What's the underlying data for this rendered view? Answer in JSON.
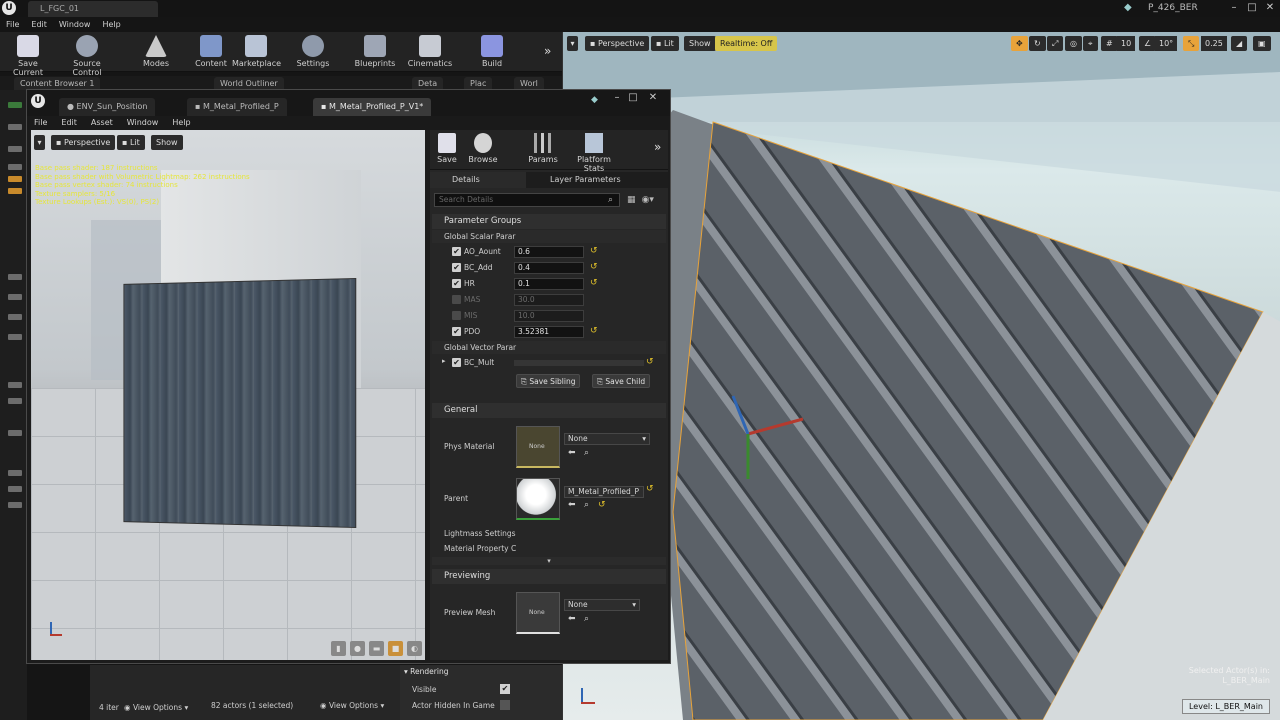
{
  "main_window": {
    "level_tab": "L_FGC_01",
    "project_name": "P_426_BER",
    "menu": [
      "File",
      "Edit",
      "Window",
      "Help"
    ]
  },
  "main_toolbar": {
    "items": [
      {
        "label": "Save Current",
        "icon": "save-icon"
      },
      {
        "label": "Source Control",
        "icon": "source-control-icon"
      },
      {
        "label": "Modes",
        "icon": "modes-icon"
      },
      {
        "label": "Content",
        "icon": "content-icon"
      },
      {
        "label": "Marketplace",
        "icon": "marketplace-icon"
      },
      {
        "label": "Settings",
        "icon": "settings-icon"
      },
      {
        "label": "Blueprints",
        "icon": "blueprints-icon"
      },
      {
        "label": "Cinematics",
        "icon": "cinematics-icon"
      },
      {
        "label": "Build",
        "icon": "build-icon"
      }
    ]
  },
  "underlay": {
    "tabs": [
      "Content Browser 1",
      "World Outliner",
      "Deta",
      "Plac",
      "Worl"
    ],
    "items_count": "4 iter",
    "view_options_1": "View Options",
    "actors_status": "82 actors (1 selected)",
    "view_options_2": "View Options",
    "rendering": {
      "title": "Rendering",
      "visible_label": "Visible",
      "actor_hidden_label": "Actor Hidden In Game"
    }
  },
  "viewport": {
    "perspective": "Perspective",
    "lit": "Lit",
    "show": "Show",
    "realtime": "Realtime: Off",
    "grid_snap": "10",
    "rot_snap": "10°",
    "scale_snap": "0.25",
    "selected_label": "Selected Actor(s) in:",
    "selected_level": "L_BER_Main",
    "level_badge": "Level:  L_BER_Main"
  },
  "material_editor": {
    "tabs": [
      "ENV_Sun_Position",
      "M_Metal_Profiled_P",
      "M_Metal_Profiled_P_V1*"
    ],
    "menu": [
      "File",
      "Edit",
      "Asset",
      "Window",
      "Help"
    ],
    "preview": {
      "perspective": "Perspective",
      "lit": "Lit",
      "show": "Show",
      "stats": [
        "Base pass shader: 187 instructions",
        "Base pass shader with Volumetric Lightmap: 262 instructions",
        "Base pass vertex shader: 74 instructions",
        "Texture samplers: 5/16",
        "Texture Lookups (Est.): VS(0), PS(2)"
      ]
    },
    "toolbar": [
      {
        "label": "Save",
        "icon": "save-icon"
      },
      {
        "label": "Browse",
        "icon": "browse-icon"
      },
      {
        "label": "Params",
        "icon": "params-icon"
      },
      {
        "label": "Platform Stats",
        "icon": "platform-stats-icon"
      }
    ],
    "details_tab": "Details",
    "layer_tab": "Layer Parameters",
    "search_placeholder": "Search Details",
    "parameter_groups": "Parameter Groups",
    "global_scalar": "Global Scalar Parar",
    "scalars": [
      {
        "name": "AO_Aount",
        "value": "0.6",
        "enabled": true
      },
      {
        "name": "BC_Add",
        "value": "0.4",
        "enabled": true
      },
      {
        "name": "HR",
        "value": "0.1",
        "enabled": true
      },
      {
        "name": "MAS",
        "value": "30.0",
        "enabled": false
      },
      {
        "name": "MIS",
        "value": "10.0",
        "enabled": false
      },
      {
        "name": "PDO",
        "value": "3.52381",
        "enabled": true
      }
    ],
    "global_vector": "Global Vector Parar",
    "vector_param": "BC_Mult",
    "save_sibling": "Save Sibling",
    "save_child": "Save Child",
    "general": {
      "title": "General",
      "phys_material_label": "Phys Material",
      "phys_material_value": "None",
      "parent_label": "Parent",
      "parent_value": "M_Metal_Profiled_P",
      "lightmass": "Lightmass Settings",
      "material_property": "Material Property C"
    },
    "previewing": {
      "title": "Previewing",
      "mesh_label": "Preview Mesh",
      "mesh_value": "None"
    },
    "thumb_none": "None"
  },
  "colors": {
    "accent_yellow": "#e2c22a",
    "selection_orange": "#e8a33a"
  }
}
